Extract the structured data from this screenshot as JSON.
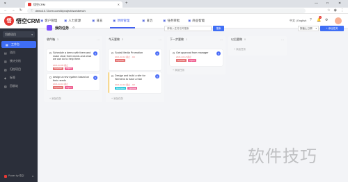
{
  "browser": {
    "tab_title": "悟空CRM",
    "url": "demo10.72crm.com/#/project/workbench",
    "lang": "中文 | English",
    "badge_count": "1"
  },
  "app": {
    "logo_letter": "悟",
    "logo_text": "悟空CRM",
    "nav": [
      {
        "label": "客户管理"
      },
      {
        "label": "人力资源"
      },
      {
        "label": "日志"
      },
      {
        "label": "项目管理"
      },
      {
        "label": "日历"
      },
      {
        "label": "任务审批"
      },
      {
        "label": "商业智能"
      }
    ]
  },
  "sidebar": {
    "select_label": "切换项目",
    "items": [
      {
        "label": "工作台"
      },
      {
        "label": "项目"
      },
      {
        "label": "统计分析"
      },
      {
        "label": "归档项目"
      },
      {
        "label": "标签"
      },
      {
        "label": "回收站"
      }
    ],
    "footer": "Power by 悟空"
  },
  "page": {
    "title": "我的任务",
    "search_placeholder": "请输入任务名称搜索",
    "search_button": "搜索",
    "filter": "按截止日期",
    "add_button": "+ 添加任务"
  },
  "columns": [
    {
      "title": "收件箱",
      "count": "3",
      "add_label": "+ 添加任务",
      "cards": [
        {
          "text": "Schedule a demo with them and make clear their needs and what we can do to help them",
          "date": "2021-02-09 截止",
          "tags": [
            "Important",
            "Urgent"
          ],
          "avatar": "王"
        },
        {
          "text": "design a new system based on their needs",
          "date": "2021-02-16 截止",
          "tags": [
            "Important",
            "Urgent"
          ],
          "avatar": "王"
        }
      ]
    },
    {
      "title": "今天要做",
      "count": "2",
      "add_label": "+ 添加任务",
      "cards": [
        {
          "text": "Social Media Promotion",
          "date": "2021-02-12 截止 · 0/1",
          "tags": [
            "Important"
          ],
          "avatar": "王"
        },
        {
          "text": "Design and build a site for Siemens to have a trial",
          "date": "2021-02-10 截止 · 0/2",
          "tags": [
            "Must Have",
            "Optional"
          ],
          "avatar": "王"
        }
      ]
    },
    {
      "title": "下一步要做",
      "count": "1",
      "add_label": "+ 添加任务",
      "cards": [
        {
          "text": "Get approval from manager",
          "date": "2021-02-18 截止",
          "tags": [
            "Important",
            "Urgent"
          ],
          "avatar": "王"
        }
      ]
    },
    {
      "title": "以后要做",
      "count": "0",
      "add_label": "+ 添加任务",
      "cards": []
    }
  ],
  "tag_colors": {
    "Important": "#e57373",
    "Urgent": "#f06292",
    "Must Have": "#26c6da",
    "Optional": "#ec6a9b"
  },
  "watermark": "软件技巧"
}
